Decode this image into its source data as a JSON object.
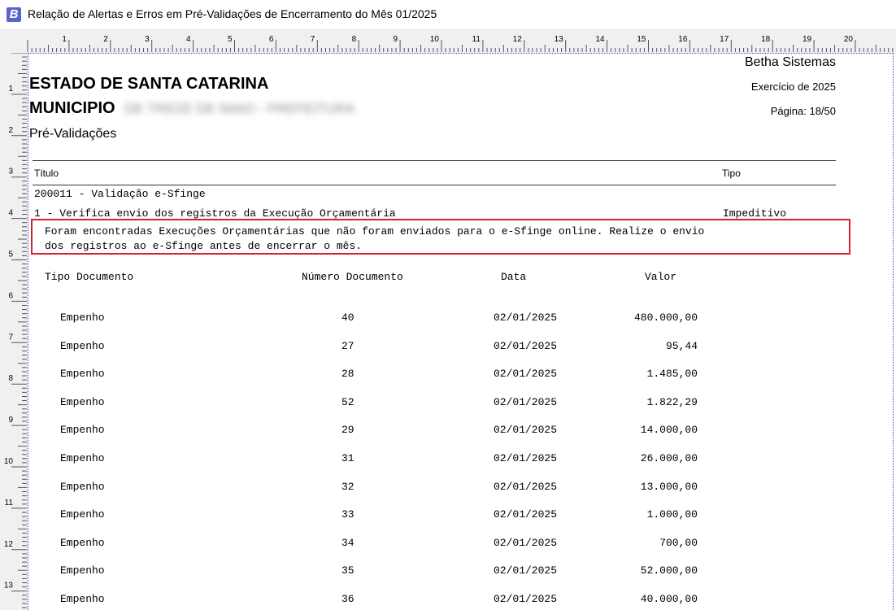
{
  "window": {
    "title": "Relação de Alertas e Erros em Pré-Validações de Encerramento do Mês 01/2025",
    "icon": "betha-app-icon"
  },
  "ruler": {
    "horizontal_labels": [
      "1",
      "2",
      "3",
      "4",
      "5",
      "6",
      "7",
      "8",
      "9",
      "10",
      "11",
      "12",
      "13",
      "14",
      "15",
      "16",
      "17",
      "18",
      "19",
      "20"
    ],
    "vertical_labels": [
      "1",
      "2",
      "3",
      "4",
      "5",
      "6",
      "7",
      "8",
      "9",
      "10",
      "11",
      "12",
      "13"
    ]
  },
  "report": {
    "company": "Betha Sistemas",
    "exercise": "Exercício de 2025",
    "page": "Página: 18/50",
    "state": "ESTADO DE SANTA CATARINA",
    "municipality_label": "MUNICIPIO",
    "municipality_name": "DE TREZE DE MAIO - PREFEITURA",
    "section": "Pré-Validações",
    "col_title": "Título",
    "col_type": "Tipo",
    "validation_group": "200011 - Validação e-Sfinge",
    "validation_item": "1 - Verifica envio dos registros da Execução Orçamentária",
    "validation_type": "Impeditivo",
    "message_line1": "Foram encontradas Execuções Orçamentárias que não foram enviados para o e-Sfinge online. Realize o envio",
    "message_line2": "dos registros ao e-Sfinge antes de encerrar o mês.",
    "table": {
      "headers": [
        "Tipo Documento",
        "Número Documento",
        "Data",
        "Valor"
      ],
      "rows": [
        {
          "tipo": "Empenho",
          "numero": "40",
          "data": "02/01/2025",
          "valor": "480.000,00"
        },
        {
          "tipo": "Empenho",
          "numero": "27",
          "data": "02/01/2025",
          "valor": "95,44"
        },
        {
          "tipo": "Empenho",
          "numero": "28",
          "data": "02/01/2025",
          "valor": "1.485,00"
        },
        {
          "tipo": "Empenho",
          "numero": "52",
          "data": "02/01/2025",
          "valor": "1.822,29"
        },
        {
          "tipo": "Empenho",
          "numero": "29",
          "data": "02/01/2025",
          "valor": "14.000,00"
        },
        {
          "tipo": "Empenho",
          "numero": "31",
          "data": "02/01/2025",
          "valor": "26.000,00"
        },
        {
          "tipo": "Empenho",
          "numero": "32",
          "data": "02/01/2025",
          "valor": "13.000,00"
        },
        {
          "tipo": "Empenho",
          "numero": "33",
          "data": "02/01/2025",
          "valor": "1.000,00"
        },
        {
          "tipo": "Empenho",
          "numero": "34",
          "data": "02/01/2025",
          "valor": "700,00"
        },
        {
          "tipo": "Empenho",
          "numero": "35",
          "data": "02/01/2025",
          "valor": "52.000,00"
        },
        {
          "tipo": "Empenho",
          "numero": "36",
          "data": "02/01/2025",
          "valor": "40.000,00"
        }
      ]
    }
  },
  "colors": {
    "highlight_border": "#d9202a",
    "page_border": "#3a3acb",
    "app_icon": "#5a63c9"
  }
}
